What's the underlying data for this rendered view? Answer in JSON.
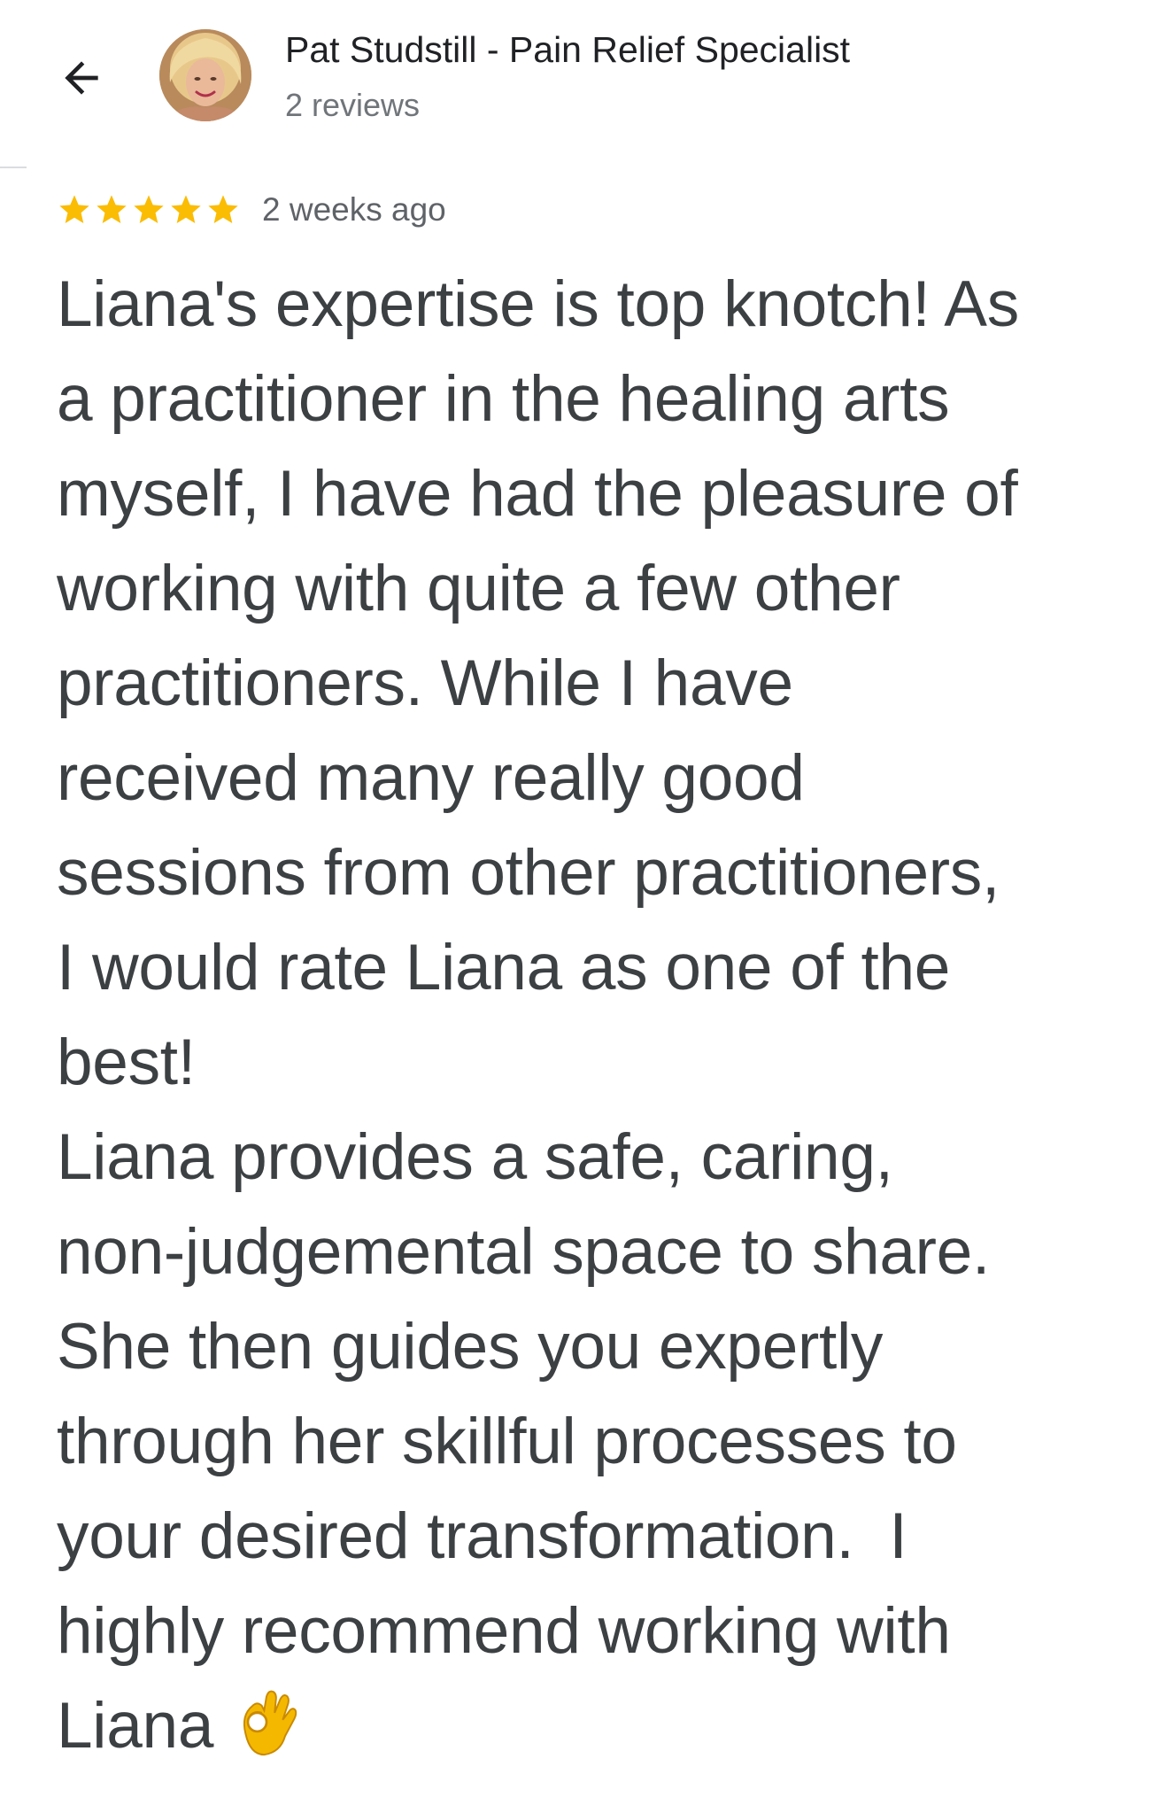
{
  "header": {
    "back_icon": "arrow-back-icon",
    "avatar_icon": "reviewer-avatar",
    "reviewer_name": "Pat Studstill - Pain Relief Specialist",
    "reviewer_meta": "2 reviews"
  },
  "review": {
    "rating": 5,
    "max_rating": 5,
    "star_color": "#fbbc04",
    "date": "2 weeks ago",
    "lines": [
      "Liana's expertise is top knotch! As",
      "a practitioner in the healing arts",
      "myself, I have had the pleasure of",
      "working with quite a few other",
      "practitioners. While I have",
      "received many really good",
      "sessions from other practitioners,",
      "I would rate Liana as one of the",
      "best!",
      "Liana provides a safe, caring,",
      "non-judgemental space to share.",
      "She then guides you expertly",
      "through her skillful processes to",
      "your desired transformation.  I",
      "highly recommend working with",
      "Liana"
    ],
    "trailing_emoji": "ok-hand-emoji"
  }
}
